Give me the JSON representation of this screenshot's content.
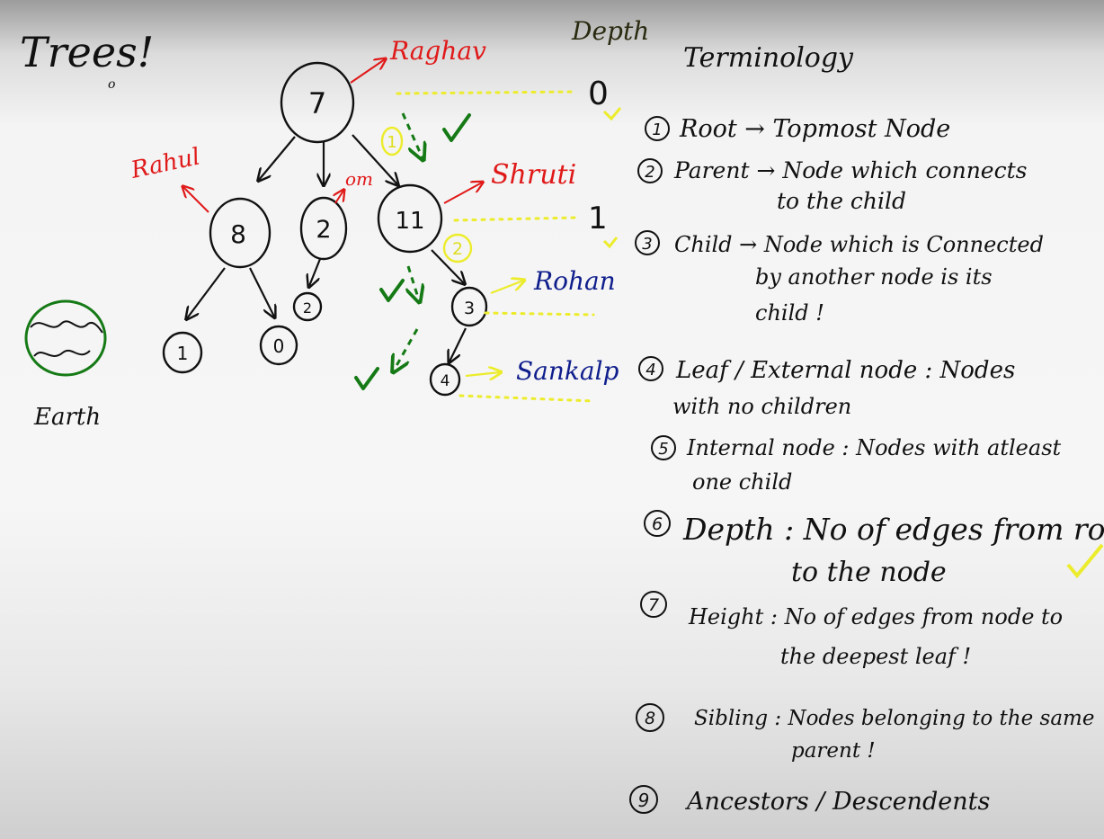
{
  "page": {
    "title": "Trees!",
    "subtitle_mark": "o"
  },
  "colors": {
    "ink": "#111111",
    "red": "#e01919",
    "blue": "#0f1e8c",
    "green": "#157a15",
    "yellow": "#ecec2c",
    "dark_olive": "#2a2a10"
  },
  "tree": {
    "nodes": [
      {
        "id": "root",
        "value": "7",
        "owner": "Raghav"
      },
      {
        "id": "n8",
        "value": "8",
        "owner": "Rahul"
      },
      {
        "id": "n2",
        "value": "2",
        "owner": "om"
      },
      {
        "id": "n11",
        "value": "11",
        "owner": "Shruti"
      },
      {
        "id": "n1",
        "value": "1"
      },
      {
        "id": "n0",
        "value": "0"
      },
      {
        "id": "n2b",
        "value": "2"
      },
      {
        "id": "n3",
        "value": "3",
        "owner": "Rohan"
      },
      {
        "id": "n4",
        "value": "4",
        "owner": "Sankalp"
      }
    ],
    "step_markers": [
      "1",
      "2"
    ]
  },
  "depth": {
    "heading": "Depth",
    "levels": [
      "0",
      "1"
    ]
  },
  "earth": {
    "label": "Earth"
  },
  "terminology": {
    "heading": "Terminology",
    "items": [
      {
        "number": "1",
        "lines": [
          "Root → Topmost Node"
        ]
      },
      {
        "number": "2",
        "lines": [
          "Parent → Node which connects",
          "to the child"
        ]
      },
      {
        "number": "3",
        "lines": [
          "Child → Node which is Connected",
          "by another node is its",
          "child !"
        ]
      },
      {
        "number": "4",
        "lines": [
          "Leaf / External node : Nodes",
          "with no children"
        ]
      },
      {
        "number": "5",
        "lines": [
          "Internal node : Nodes with atleast",
          "one child"
        ]
      },
      {
        "number": "6",
        "lines": [
          "Depth : No of edges from root",
          "to the node"
        ]
      },
      {
        "number": "7",
        "lines": [
          "Height : No of edges from node to",
          "the deepest leaf !"
        ]
      },
      {
        "number": "8",
        "lines": [
          "Sibling : Nodes belonging to the same",
          "parent !"
        ]
      },
      {
        "number": "9",
        "lines": [
          "Ancestors / Descendents"
        ]
      }
    ]
  }
}
